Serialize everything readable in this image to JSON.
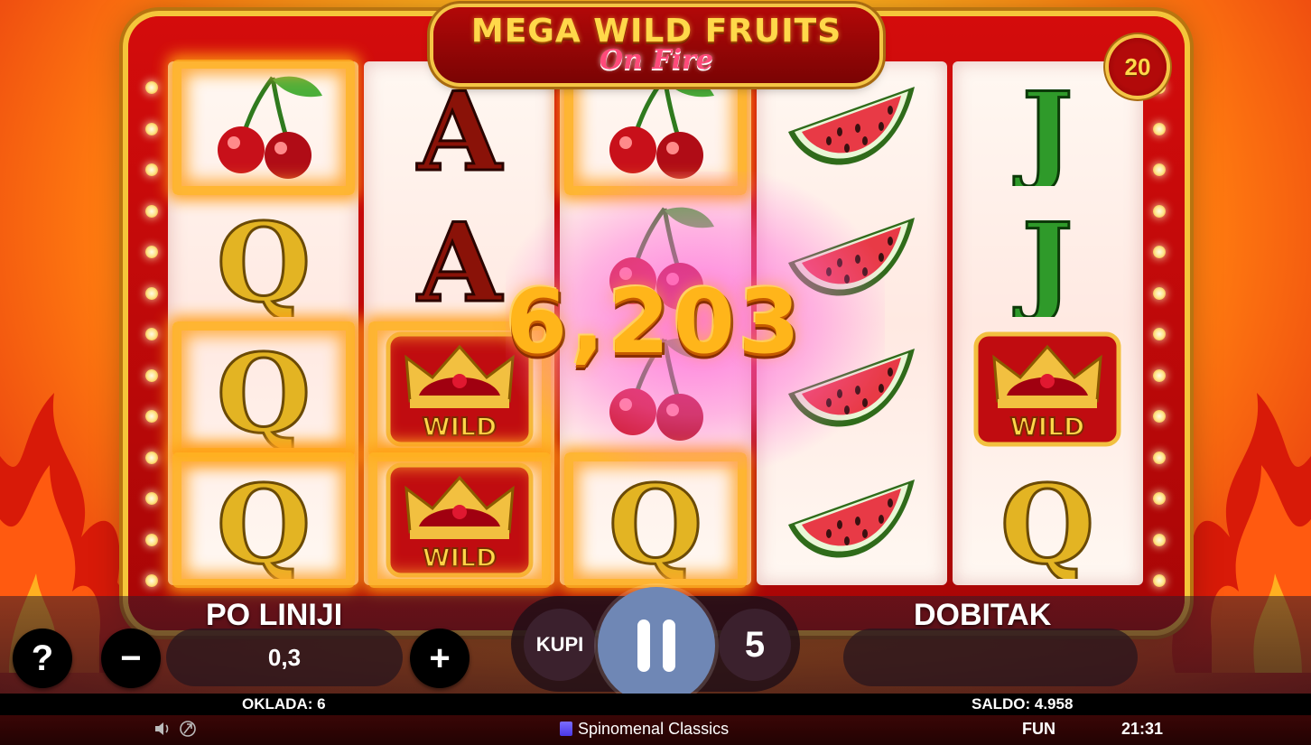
{
  "game": {
    "title": "MEGA WILD FRUITS",
    "subtitle": "On Fire",
    "lines": "20",
    "win_amount": "6,203"
  },
  "reels": [
    [
      {
        "symbol": "cherry",
        "burning": true
      },
      {
        "symbol": "Q",
        "burning": false
      },
      {
        "symbol": "Q",
        "burning": true
      },
      {
        "symbol": "Q",
        "burning": true
      }
    ],
    [
      {
        "symbol": "A",
        "burning": false
      },
      {
        "symbol": "A",
        "burning": false
      },
      {
        "symbol": "wild-crown",
        "burning": true
      },
      {
        "symbol": "wild-crown",
        "burning": true
      }
    ],
    [
      {
        "symbol": "cherry",
        "burning": true
      },
      {
        "symbol": "cherry",
        "burning": false
      },
      {
        "symbol": "cherry",
        "burning": false
      },
      {
        "symbol": "Q",
        "burning": true
      }
    ],
    [
      {
        "symbol": "watermelon",
        "burning": false
      },
      {
        "symbol": "watermelon",
        "burning": false
      },
      {
        "symbol": "watermelon",
        "burning": false
      },
      {
        "symbol": "watermelon",
        "burning": false
      }
    ],
    [
      {
        "symbol": "J",
        "burning": false
      },
      {
        "symbol": "J",
        "burning": false
      },
      {
        "symbol": "wild-crown",
        "burning": false
      },
      {
        "symbol": "Q",
        "burning": false
      }
    ]
  ],
  "wild_label": "WILD",
  "controls": {
    "help_label": "?",
    "minus_label": "−",
    "plus_label": "+",
    "per_line_label": "PO LINIJI",
    "per_line_value": "0,3",
    "buy_label": "KUPI",
    "autospin_count": "5",
    "win_label": "DOBITAK",
    "win_value": ""
  },
  "info": {
    "bet": "OKLADA: 6",
    "balance": "SALDO: 4.958"
  },
  "status": {
    "provider": "Spinomenal Classics",
    "mode": "FUN",
    "time": "21:31"
  },
  "icons": {
    "sound": "speaker-icon",
    "turbo": "turbo-icon",
    "brand": "spinomenal-logo-icon"
  },
  "colors": {
    "accent_gold": "#ffd84a",
    "cabinet_red": "#d40c0c",
    "spin_button": "#6f87b5"
  }
}
